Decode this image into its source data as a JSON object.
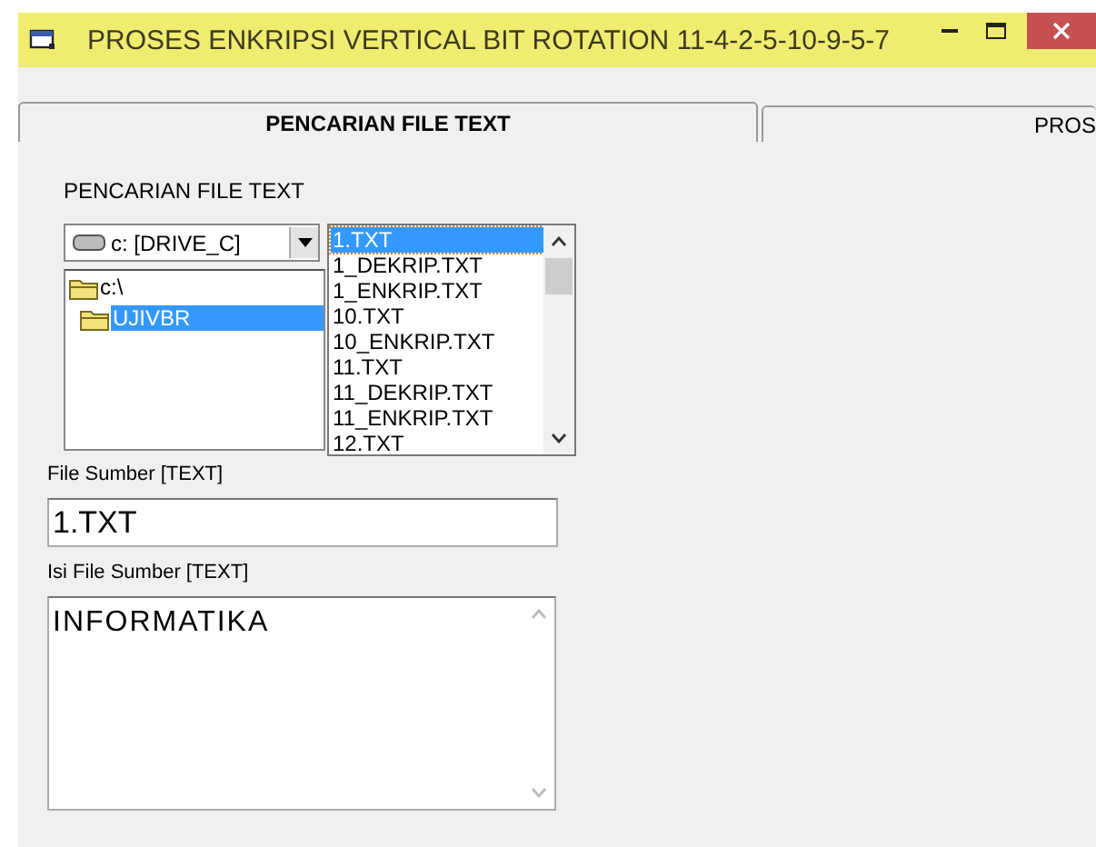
{
  "window": {
    "title": "PROSES ENKRIPSI VERTICAL BIT ROTATION  11-4-2-5-10-9-5-7"
  },
  "tabs": [
    {
      "label": "PENCARIAN FILE TEXT",
      "selected": true
    },
    {
      "label": "PROS",
      "selected": false
    }
  ],
  "panel": {
    "heading": "PENCARIAN FILE TEXT",
    "drive": {
      "value": "c: [DRIVE_C]"
    },
    "directories": [
      {
        "name": "c:\\",
        "selected": false,
        "children": [
          {
            "name": "UJIVBR",
            "selected": true
          }
        ]
      }
    ],
    "files": [
      {
        "name": "1.TXT",
        "selected": true
      },
      {
        "name": "1_DEKRIP.TXT",
        "selected": false
      },
      {
        "name": "1_ENKRIP.TXT",
        "selected": false
      },
      {
        "name": "10.TXT",
        "selected": false
      },
      {
        "name": "10_ENKRIP.TXT",
        "selected": false
      },
      {
        "name": "11.TXT",
        "selected": false
      },
      {
        "name": "11_DEKRIP.TXT",
        "selected": false
      },
      {
        "name": "11_ENKRIP.TXT",
        "selected": false
      },
      {
        "name": "12.TXT",
        "selected": false
      }
    ],
    "source_file": {
      "label": "File Sumber [TEXT]",
      "value": "1.TXT"
    },
    "source_content": {
      "label": "Isi File Sumber [TEXT]",
      "value": "INFORMATIKA"
    }
  }
}
